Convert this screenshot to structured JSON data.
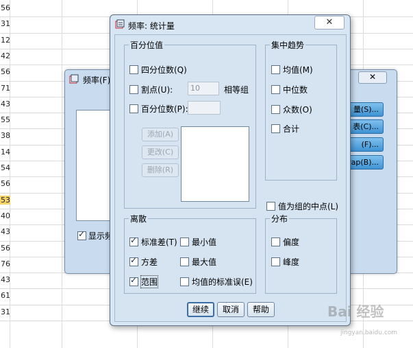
{
  "sheet": {
    "row_numbers": [
      "56",
      "31",
      "12",
      "42",
      "56",
      "71",
      "43",
      "55",
      "38",
      "14",
      "54",
      "56",
      "53",
      "40",
      "43",
      "56",
      "76",
      "43",
      "61",
      "31"
    ],
    "highlight_index": 12
  },
  "back_dialog": {
    "title": "频率(F)",
    "close_label": "✕",
    "show_check_label": "显示频",
    "side_buttons": [
      "量(S)...",
      "表(C)...",
      "(F)...",
      "rap(B)..."
    ]
  },
  "dialog": {
    "title": "频率: 统计量",
    "close_label": "✕",
    "percentile": {
      "legend": "百分位值",
      "quartiles": "四分位数(Q)",
      "cut_points": "割点(U):",
      "cut_value": "10",
      "equal_groups": "相等组",
      "percentiles": "百分位数(P):",
      "add": "添加(A)",
      "change": "更改(C)",
      "remove": "删除(R)"
    },
    "central": {
      "legend": "集中趋势",
      "mean": "均值(M)",
      "median": "中位数",
      "mode": "众数(O)",
      "sum": "合计"
    },
    "midpoint": "值为组的中点(L)",
    "dispersion": {
      "legend": "离散",
      "std": "标准差(T)",
      "min": "最小值",
      "variance": "方差",
      "max": "最大值",
      "range": "范围",
      "se_mean": "均值的标准误(E)"
    },
    "distribution": {
      "legend": "分布",
      "skewness": "偏度",
      "kurtosis": "峰度"
    },
    "buttons": {
      "continue": "继续",
      "cancel": "取消",
      "help": "帮助"
    }
  },
  "watermark": {
    "brand": "Bai 经验",
    "url": "jingyan.baidu.com"
  }
}
